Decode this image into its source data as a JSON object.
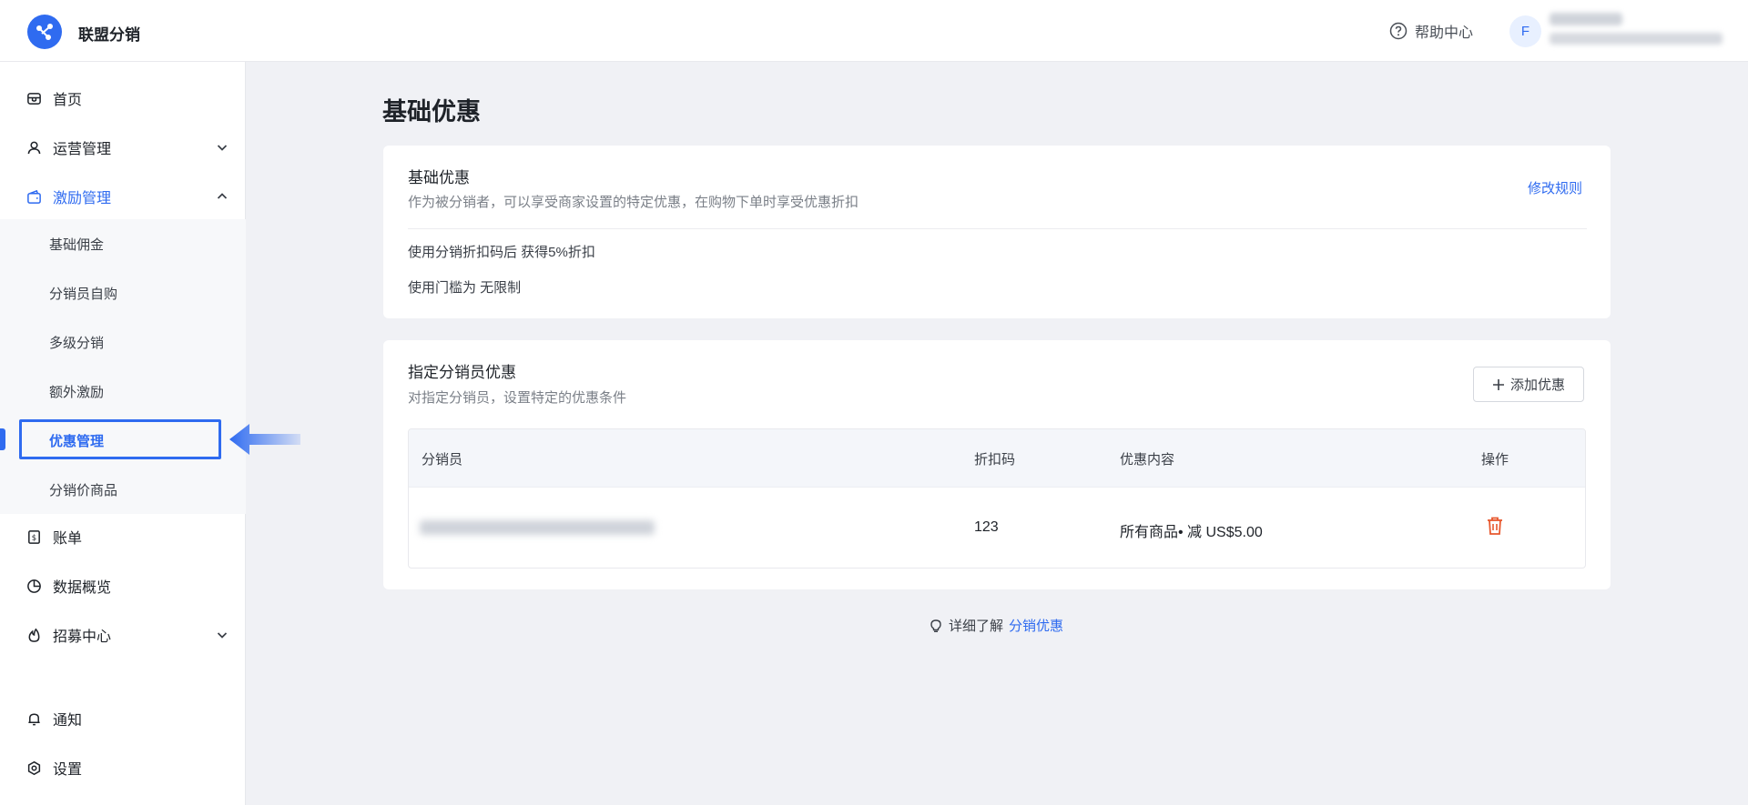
{
  "header": {
    "brand": "联盟分销",
    "help_label": "帮助中心",
    "avatar_initial": "F"
  },
  "sidebar": {
    "items": [
      {
        "label": "首页",
        "icon": "store-icon"
      },
      {
        "label": "运营管理",
        "icon": "user-icon"
      },
      {
        "label": "激励管理",
        "icon": "wallet-icon"
      },
      {
        "label": "账单",
        "icon": "bill-icon"
      },
      {
        "label": "数据概览",
        "icon": "pie-chart-icon"
      },
      {
        "label": "招募中心",
        "icon": "fire-icon"
      },
      {
        "label": "通知",
        "icon": "bell-icon"
      },
      {
        "label": "设置",
        "icon": "settings-icon"
      }
    ],
    "submenu": [
      {
        "label": "基础佣金"
      },
      {
        "label": "分销员自购"
      },
      {
        "label": "多级分销"
      },
      {
        "label": "额外激励"
      },
      {
        "label": "优惠管理"
      },
      {
        "label": "分销价商品"
      }
    ]
  },
  "main": {
    "page_title": "基础优惠",
    "basic_card": {
      "title": "基础优惠",
      "description": "作为被分销者，可以享受商家设置的特定优惠，在购物下单时享受优惠折扣",
      "edit_link": "修改规则",
      "rule_discount": "使用分销折扣码后 获得5%折扣",
      "rule_threshold": "使用门槛为 无限制"
    },
    "assigned_card": {
      "title": "指定分销员优惠",
      "description": "对指定分销员，设置特定的优惠条件",
      "add_button": "添加优惠",
      "columns": [
        "分销员",
        "折扣码",
        "优惠内容",
        "操作"
      ],
      "rows": [
        {
          "code": "123",
          "content": "所有商品• 减 US$5.00"
        }
      ]
    },
    "footer": {
      "text": "详细了解",
      "link": "分销优惠"
    }
  },
  "colors": {
    "accent": "#2f6bf0",
    "danger": "#e8582e",
    "background": "#f0f1f5"
  }
}
